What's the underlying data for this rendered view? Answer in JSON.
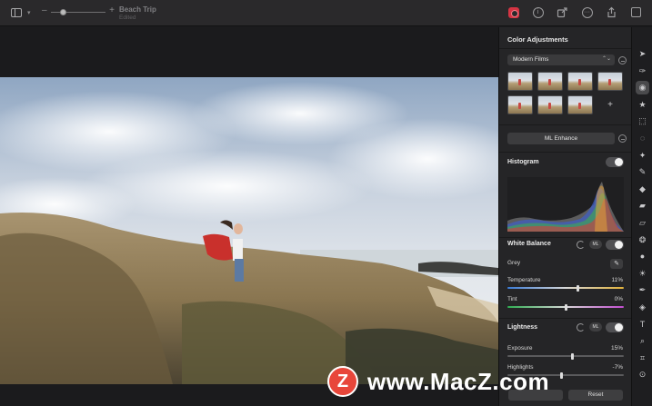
{
  "toolbar": {
    "doc_title": "Beach Trip",
    "doc_subtitle": "Edited",
    "zoom_minus": "–",
    "zoom_plus": "+",
    "info_glyph": "i",
    "more_glyph": "···",
    "caret_glyph": "▾",
    "icons": [
      "sidebar-icon",
      "zoom-slider",
      "magic-red-icon",
      "info-icon",
      "share-arrow-icon",
      "more-icon",
      "export-icon",
      "window-icon"
    ]
  },
  "panel": {
    "title": "Color Adjustments",
    "preset_select": "Modern Films",
    "preset_select_arrow": "⌃⌄",
    "add_preset": "+",
    "ml_enhance": "ML Enhance",
    "histogram": {
      "title": "Histogram"
    },
    "white_balance": {
      "title": "White Balance",
      "ml_badge": "ML",
      "grey_label": "Grey",
      "picker_glyph": "✎",
      "temperature": {
        "label": "Temperature",
        "value": "11%",
        "level": 0.61
      },
      "tint": {
        "label": "Tint",
        "value": "0%",
        "level": 0.5
      }
    },
    "lightness": {
      "title": "Lightness",
      "ml_badge": "ML",
      "exposure": {
        "label": "Exposure",
        "value": "15%",
        "level": 0.56
      },
      "highlights": {
        "label": "Highlights",
        "value": "-7%",
        "level": 0.46
      }
    },
    "bottom": {
      "reset": "Reset"
    }
  },
  "rail": {
    "tools": [
      {
        "name": "arrow-tool-icon",
        "glyph": "➤"
      },
      {
        "name": "pen-tool-icon",
        "glyph": "✑"
      },
      {
        "name": "color-adjust-tool-icon",
        "glyph": "◉"
      },
      {
        "name": "star-tool-icon",
        "glyph": "★"
      },
      {
        "name": "select-rect-tool-icon",
        "glyph": "⬚"
      },
      {
        "name": "lasso-tool-icon",
        "glyph": "◌"
      },
      {
        "name": "magic-wand-tool-icon",
        "glyph": "✦"
      },
      {
        "name": "brush-tool-icon",
        "glyph": "✎"
      },
      {
        "name": "bucket-tool-icon",
        "glyph": "◆"
      },
      {
        "name": "eraser-tool-icon",
        "glyph": "▰"
      },
      {
        "name": "smudge-tool-icon",
        "glyph": "▱"
      },
      {
        "name": "clone-tool-icon",
        "glyph": "❂"
      },
      {
        "name": "gradient-tool-icon",
        "glyph": "●"
      },
      {
        "name": "sun-tool-icon",
        "glyph": "☀"
      },
      {
        "name": "pen-path-tool-icon",
        "glyph": "✒"
      },
      {
        "name": "shapes-tool-icon",
        "glyph": "◈"
      },
      {
        "name": "text-tool-icon",
        "glyph": "T"
      },
      {
        "name": "zoom-tool-icon",
        "glyph": "⌕"
      },
      {
        "name": "crop-tool-icon",
        "glyph": "⌗"
      },
      {
        "name": "more-tool-icon",
        "glyph": "⊙"
      }
    ]
  },
  "watermark": {
    "logo_letter": "Z",
    "text": "www.MacZ.com"
  },
  "colors": {
    "accent_red": "#d53443",
    "panel_bg": "#252527",
    "canvas_bg": "#1b1b1d"
  }
}
